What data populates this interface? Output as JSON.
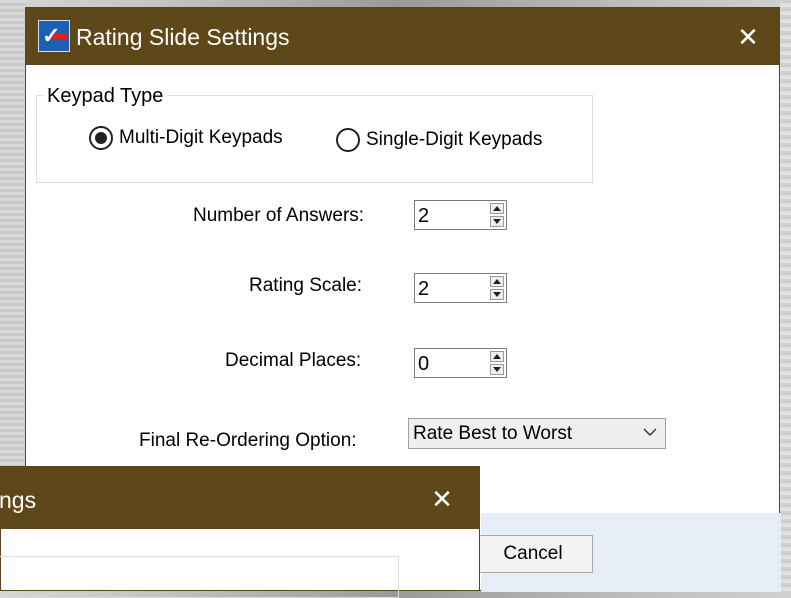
{
  "dialog": {
    "title": "Rating Slide Settings",
    "close_glyph": "✕",
    "icon": "app-logo-icon",
    "keypad_group": {
      "legend": "Keypad Type",
      "options": [
        {
          "label": "Multi-Digit Keypads",
          "selected": true
        },
        {
          "label": "Single-Digit Keypads",
          "selected": false
        }
      ]
    },
    "fields": {
      "number_of_answers": {
        "label": "Number of Answers:",
        "value": "2"
      },
      "rating_scale": {
        "label": "Rating Scale:",
        "value": "2"
      },
      "decimal_places": {
        "label": "Decimal Places:",
        "value": "0"
      },
      "final_reordering": {
        "label": "Final Re-Ordering Option:",
        "value": "Rate Best to Worst"
      }
    },
    "buttons": {
      "cancel": "Cancel"
    }
  },
  "dialog2": {
    "title": "ngs",
    "close_glyph": "✕"
  },
  "colors": {
    "titlebar": "#5e4719",
    "footer": "#e8eef7"
  }
}
